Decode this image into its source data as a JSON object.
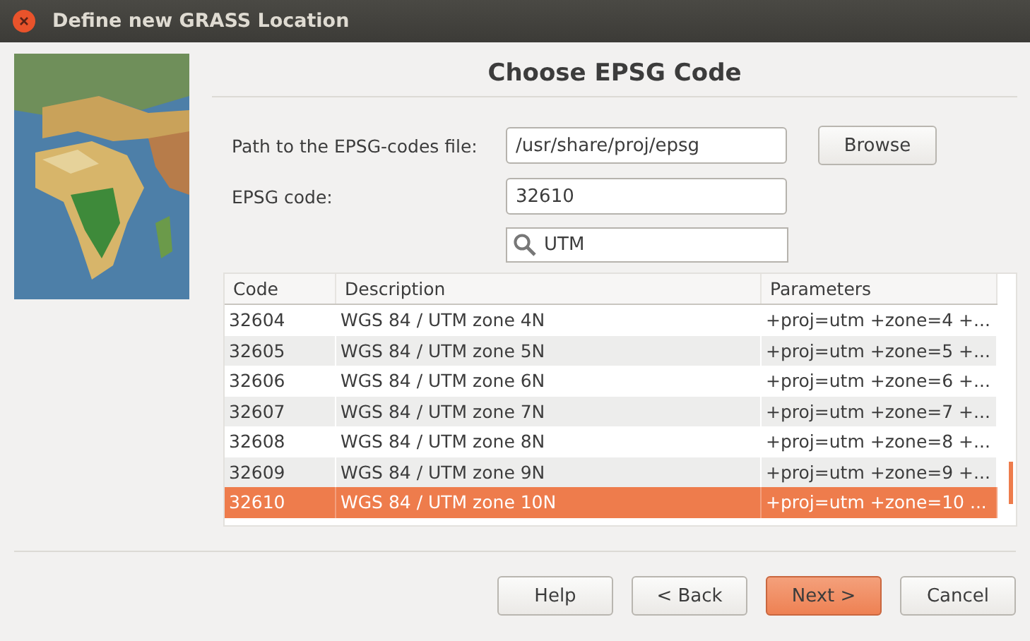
{
  "window": {
    "title": "Define new GRASS Location"
  },
  "heading": "Choose EPSG Code",
  "form": {
    "path_label": "Path to the EPSG-codes file:",
    "path_value": "/usr/share/proj/epsg",
    "browse": "Browse",
    "code_label": "EPSG code:",
    "code_value": "32610",
    "search_value": "UTM"
  },
  "table": {
    "columns": [
      "Code",
      "Description",
      "Parameters"
    ],
    "rows": [
      {
        "cells": [
          "32604",
          "WGS 84 / UTM zone 4N",
          "+proj=utm +zone=4 +..."
        ],
        "selected": false
      },
      {
        "cells": [
          "32605",
          "WGS 84 / UTM zone 5N",
          "+proj=utm +zone=5 +..."
        ],
        "selected": false
      },
      {
        "cells": [
          "32606",
          "WGS 84 / UTM zone 6N",
          "+proj=utm +zone=6 +..."
        ],
        "selected": false
      },
      {
        "cells": [
          "32607",
          "WGS 84 / UTM zone 7N",
          "+proj=utm +zone=7 +..."
        ],
        "selected": false
      },
      {
        "cells": [
          "32608",
          "WGS 84 / UTM zone 8N",
          "+proj=utm +zone=8 +..."
        ],
        "selected": false
      },
      {
        "cells": [
          "32609",
          "WGS 84 / UTM zone 9N",
          "+proj=utm +zone=9 +..."
        ],
        "selected": false
      },
      {
        "cells": [
          "32610",
          "WGS 84 / UTM zone 10N",
          "+proj=utm +zone=10 ..."
        ],
        "selected": true
      }
    ]
  },
  "buttons": [
    {
      "label": "Help",
      "default": false
    },
    {
      "label": "< Back",
      "default": false
    },
    {
      "label": "Next >",
      "default": true
    },
    {
      "label": "Cancel",
      "default": false
    }
  ]
}
